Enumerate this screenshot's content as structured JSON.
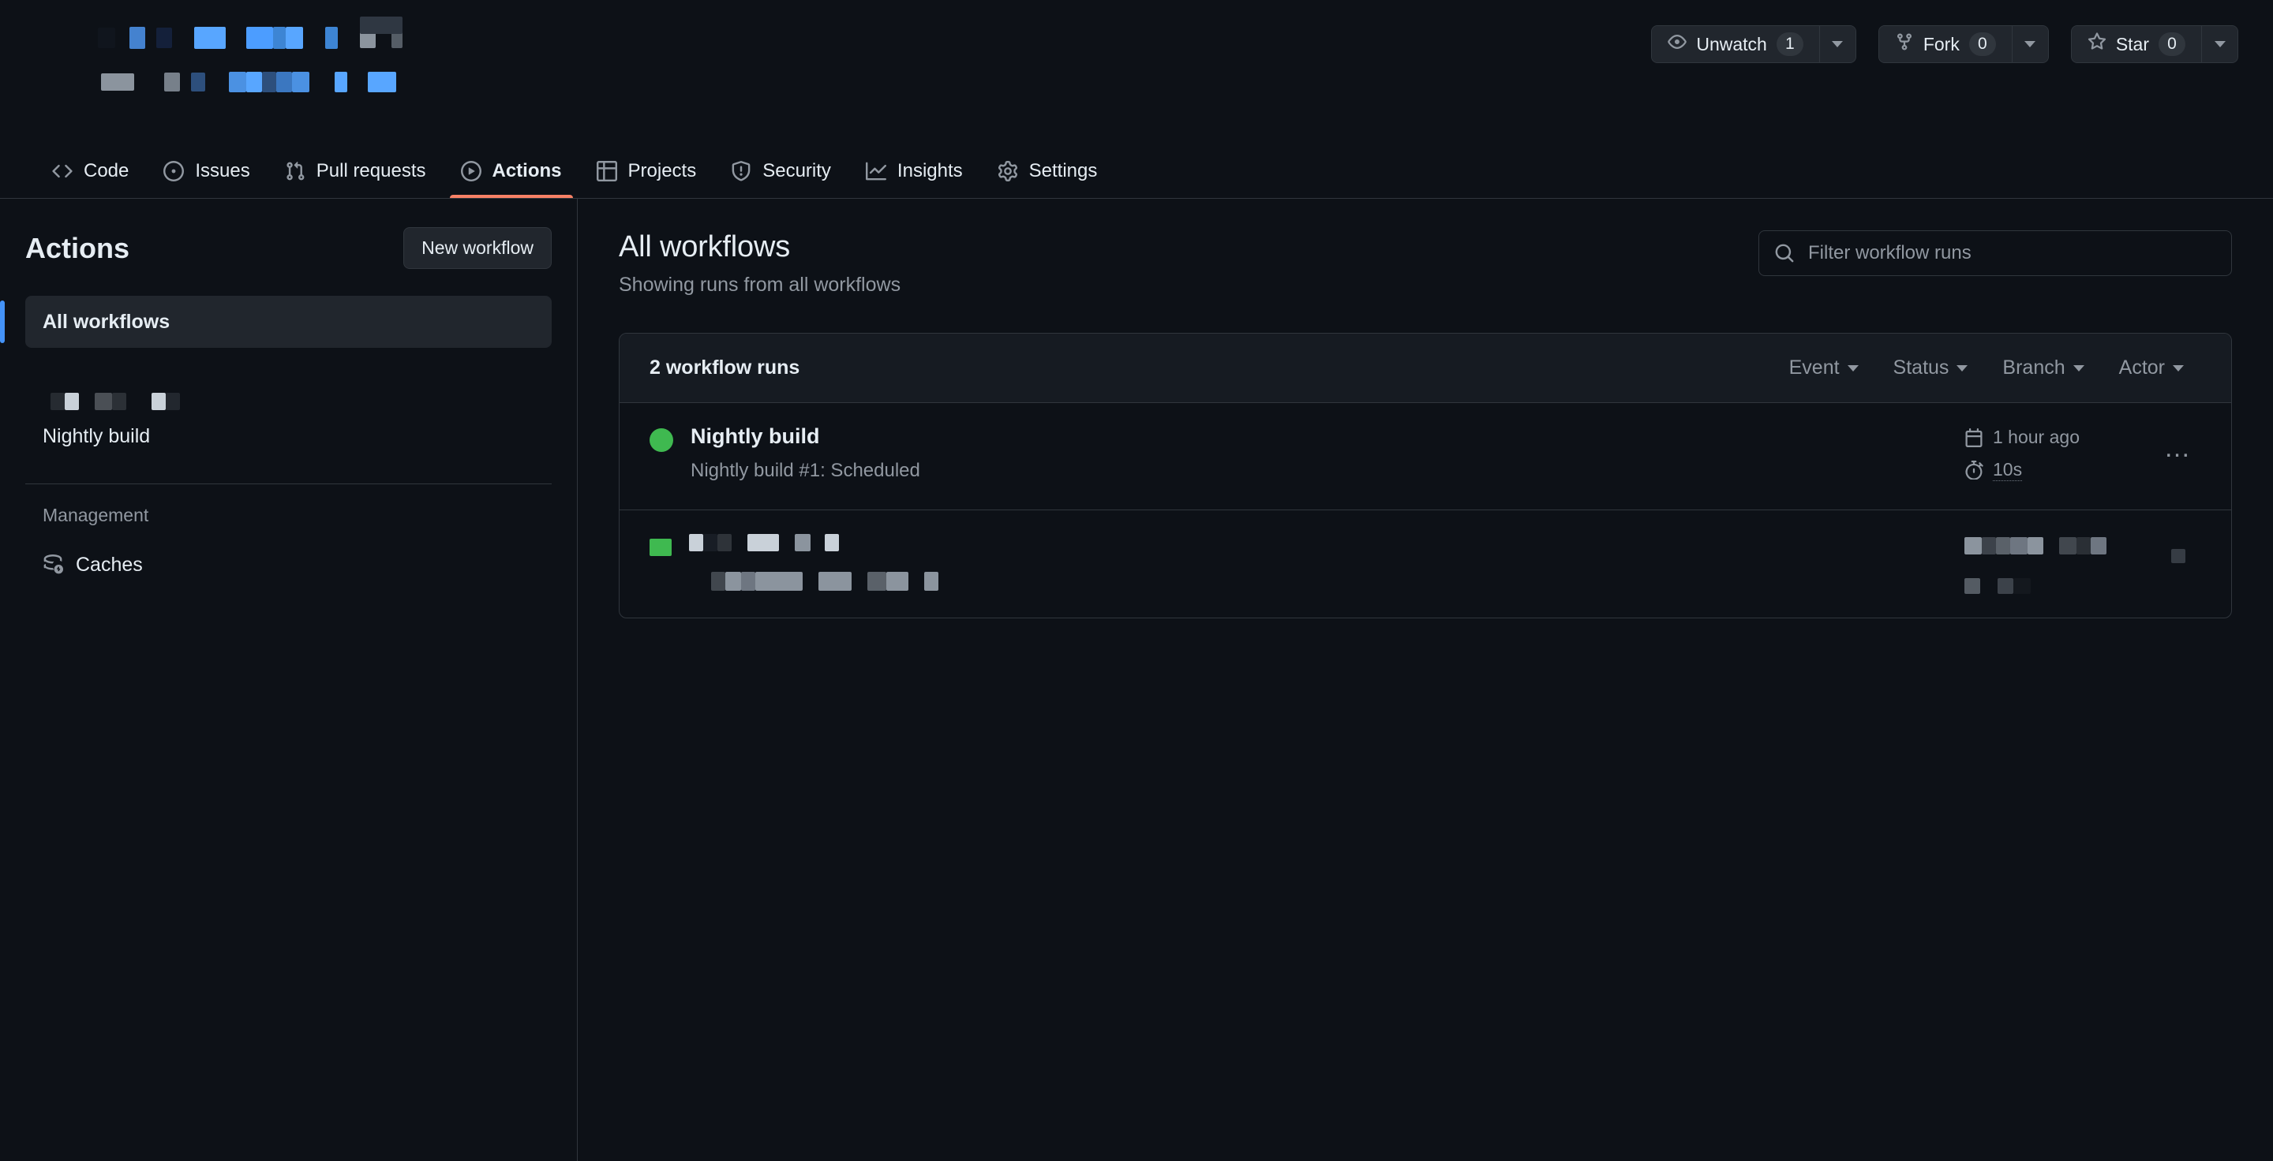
{
  "header": {
    "repo_breadcrumb_redacted": true,
    "actions": [
      {
        "id": "watch",
        "icon": "eye-icon",
        "label": "Unwatch",
        "count": "1"
      },
      {
        "id": "fork",
        "icon": "fork-icon",
        "label": "Fork",
        "count": "0"
      },
      {
        "id": "star",
        "icon": "star-icon",
        "label": "Star",
        "count": "0"
      }
    ]
  },
  "nav": {
    "tabs": [
      {
        "id": "code",
        "label": "Code",
        "icon": "code-icon",
        "active": false
      },
      {
        "id": "issues",
        "label": "Issues",
        "icon": "issue-opened-icon",
        "active": false
      },
      {
        "id": "pull-requests",
        "label": "Pull requests",
        "icon": "git-pull-request-icon",
        "active": false
      },
      {
        "id": "actions",
        "label": "Actions",
        "icon": "play-icon",
        "active": true
      },
      {
        "id": "projects",
        "label": "Projects",
        "icon": "table-icon",
        "active": false
      },
      {
        "id": "security",
        "label": "Security",
        "icon": "shield-icon",
        "active": false
      },
      {
        "id": "insights",
        "label": "Insights",
        "icon": "graph-icon",
        "active": false
      },
      {
        "id": "settings",
        "label": "Settings",
        "icon": "gear-icon",
        "active": false
      }
    ]
  },
  "sidebar": {
    "title": "Actions",
    "new_workflow_label": "New workflow",
    "all_workflows_label": "All workflows",
    "workflow_items": [
      {
        "label": "Nightly build"
      }
    ],
    "management_label": "Management",
    "management_items": [
      {
        "label": "Caches",
        "icon": "cache-icon"
      }
    ]
  },
  "main": {
    "title": "All workflows",
    "subtitle": "Showing runs from all workflows",
    "search": {
      "placeholder": "Filter workflow runs",
      "value": "",
      "icon": "search-icon"
    },
    "runs_count_label": "2 workflow runs",
    "filters": [
      {
        "id": "event",
        "label": "Event"
      },
      {
        "id": "status",
        "label": "Status"
      },
      {
        "id": "branch",
        "label": "Branch"
      },
      {
        "id": "actor",
        "label": "Actor"
      }
    ],
    "runs": [
      {
        "id": "run-1",
        "status": "success",
        "status_icon": "check-circle-fill-icon",
        "name": "Nightly build",
        "description": "Nightly build #1: Scheduled",
        "time_icon": "calendar-icon",
        "time": "1 hour ago",
        "duration_icon": "stopwatch-icon",
        "duration": "10s",
        "kebab": "…",
        "redacted": false
      },
      {
        "id": "run-2",
        "status": "success",
        "status_icon": "check-circle-fill-icon",
        "name": "",
        "description": "",
        "time": "",
        "duration": "",
        "kebab": "…",
        "redacted": true
      }
    ]
  },
  "colors": {
    "page_bg": "#0d1117",
    "surface_bg": "#161b22",
    "border": "#30363d",
    "text": "#e6edf3",
    "text_muted": "#9198a1",
    "accent_blue": "#4493f8",
    "active_tab_underline": "#f78166",
    "success_green": "#3fb950"
  }
}
